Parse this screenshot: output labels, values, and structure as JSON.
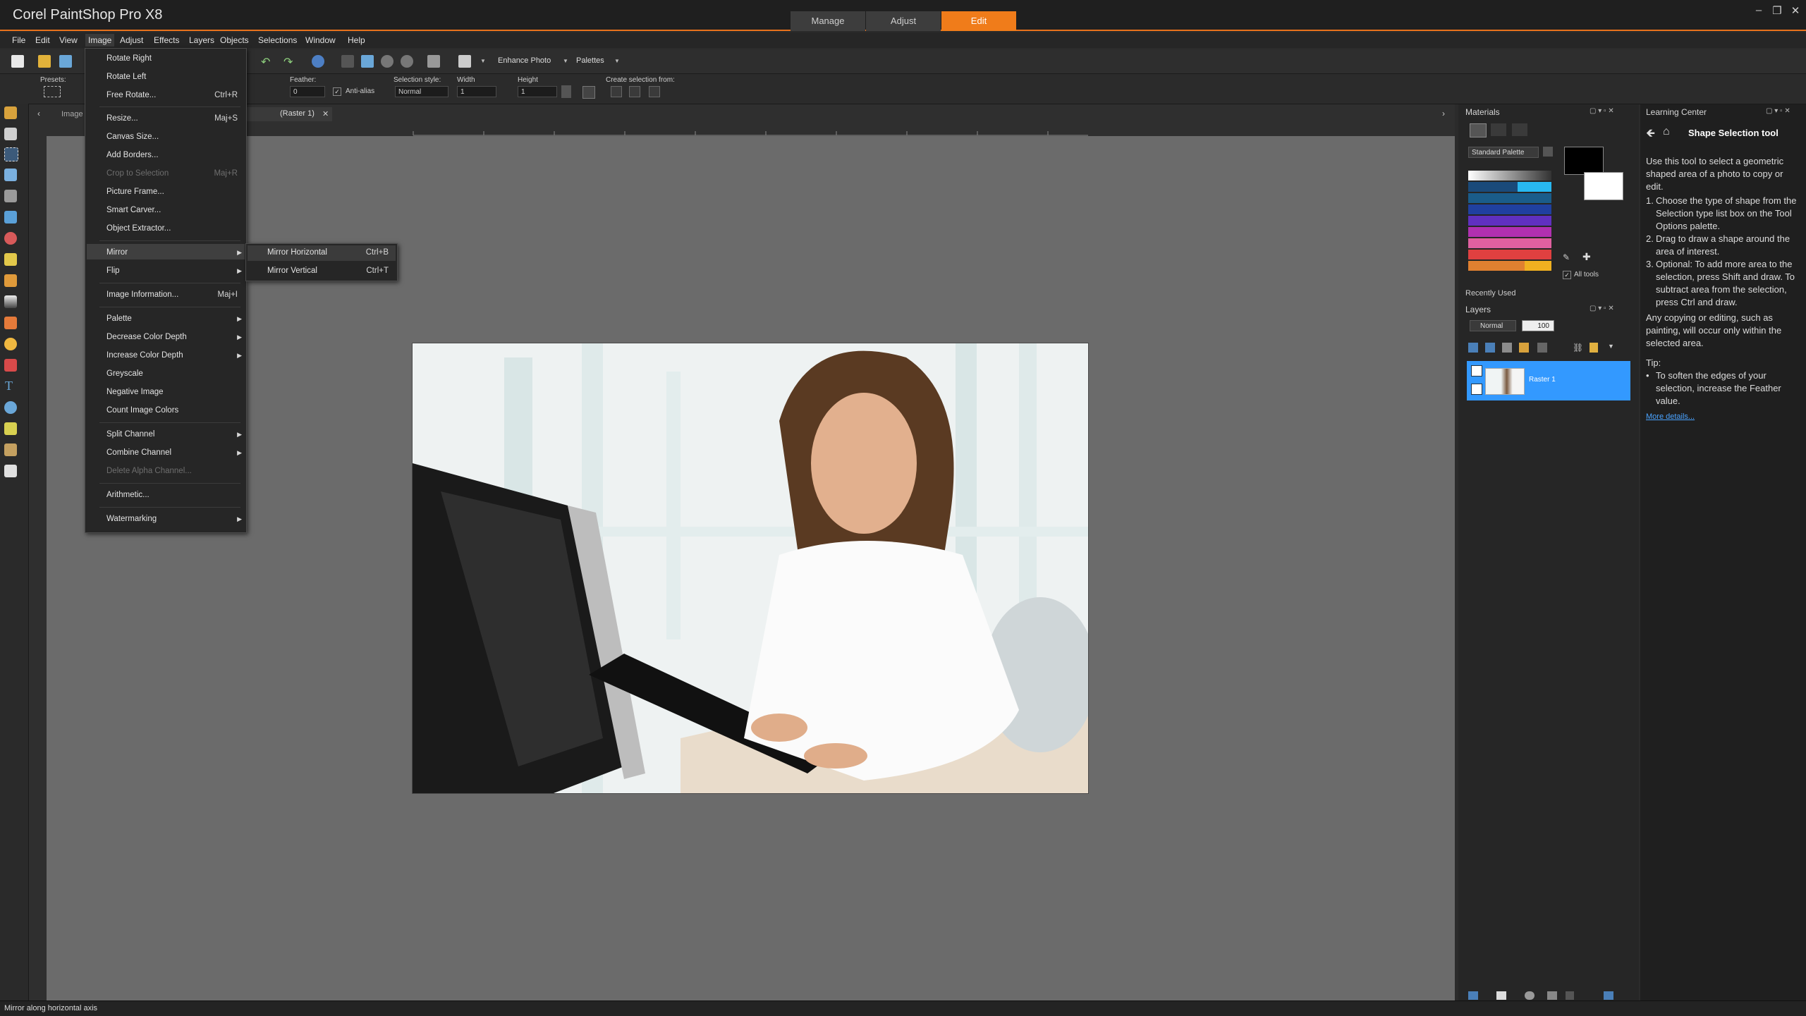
{
  "app": {
    "title": "Corel PaintShop Pro X8",
    "workspace_tabs": [
      "Manage",
      "Adjust",
      "Edit"
    ],
    "active_tab": "Edit"
  },
  "menubar": [
    "File",
    "Edit",
    "View",
    "Image",
    "Adjust",
    "Effects",
    "Layers",
    "Objects",
    "Selections",
    "Window",
    "Help"
  ],
  "toolbar": {
    "enhance_photo": "Enhance Photo",
    "palettes": "Palettes"
  },
  "tool_options": {
    "presets_label": "Presets:",
    "feather_label": "Feather:",
    "feather_value": "0",
    "antialias_label": "Anti-alias",
    "selection_style_label": "Selection style:",
    "selection_style_value": "Normal",
    "width_label": "Width",
    "height_label": "Height",
    "create_selection_label": "Create selection from:",
    "width_value": "1",
    "height_value": "1"
  },
  "document": {
    "tab_left": "Image",
    "tab_label": "(Raster 1)"
  },
  "image_menu": {
    "items": [
      {
        "label": "Rotate Right",
        "shortcut": ""
      },
      {
        "label": "Rotate Left",
        "shortcut": ""
      },
      {
        "label": "Free Rotate...",
        "shortcut": "Ctrl+R"
      },
      {
        "label": "Resize...",
        "shortcut": "Maj+S"
      },
      {
        "label": "Canvas Size...",
        "shortcut": ""
      },
      {
        "label": "Add Borders...",
        "shortcut": ""
      },
      {
        "label": "Crop to Selection",
        "shortcut": "Maj+R"
      },
      {
        "label": "Picture Frame...",
        "shortcut": ""
      },
      {
        "label": "Smart Carver...",
        "shortcut": ""
      },
      {
        "label": "Object Extractor...",
        "shortcut": ""
      },
      {
        "label": "Mirror",
        "shortcut": ""
      },
      {
        "label": "Flip",
        "shortcut": ""
      },
      {
        "label": "Image Information...",
        "shortcut": "Maj+I"
      },
      {
        "label": "Palette",
        "shortcut": ""
      },
      {
        "label": "Decrease Color Depth",
        "shortcut": ""
      },
      {
        "label": "Increase Color Depth",
        "shortcut": ""
      },
      {
        "label": "Greyscale",
        "shortcut": ""
      },
      {
        "label": "Negative Image",
        "shortcut": ""
      },
      {
        "label": "Count Image Colors",
        "shortcut": ""
      },
      {
        "label": "Split Channel",
        "shortcut": ""
      },
      {
        "label": "Combine Channel",
        "shortcut": ""
      },
      {
        "label": "Delete Alpha Channel...",
        "shortcut": ""
      },
      {
        "label": "Arithmetic...",
        "shortcut": ""
      },
      {
        "label": "Watermarking",
        "shortcut": ""
      }
    ]
  },
  "mirror_submenu": [
    {
      "label": "Mirror Horizontal",
      "shortcut": "Ctrl+B"
    },
    {
      "label": "Mirror Vertical",
      "shortcut": "Ctrl+T"
    }
  ],
  "materials": {
    "title": "Materials",
    "palette_select": "Standard Palette",
    "recently_used": "Recently Used",
    "all_tools": "All tools"
  },
  "layers": {
    "title": "Layers",
    "blend_mode": "Normal",
    "opacity": "100",
    "layer_name": "Raster 1"
  },
  "learning_center": {
    "title": "Learning Center",
    "heading": "Shape Selection tool",
    "intro": "Use this tool to select a geometric shaped area of a photo to copy or edit.",
    "steps": [
      "Choose the type of shape from the Selection type list box on the Tool Options palette.",
      "Drag to draw a shape around the area of interest.",
      "Optional: To add more area to the selection, press Shift and draw. To subtract area from the selection, press Ctrl and draw."
    ],
    "note": "Any copying or editing, such as painting, will occur only within the selected area.",
    "tip_label": "Tip:",
    "tip": "To soften the edges of your selection, increase the Feather value.",
    "more_link": "More details..."
  },
  "status": "Mirror along horizontal axis",
  "colors": {
    "accent": "#f07c1a",
    "layer_selected": "#3399ff",
    "link": "#4aa3ff"
  }
}
